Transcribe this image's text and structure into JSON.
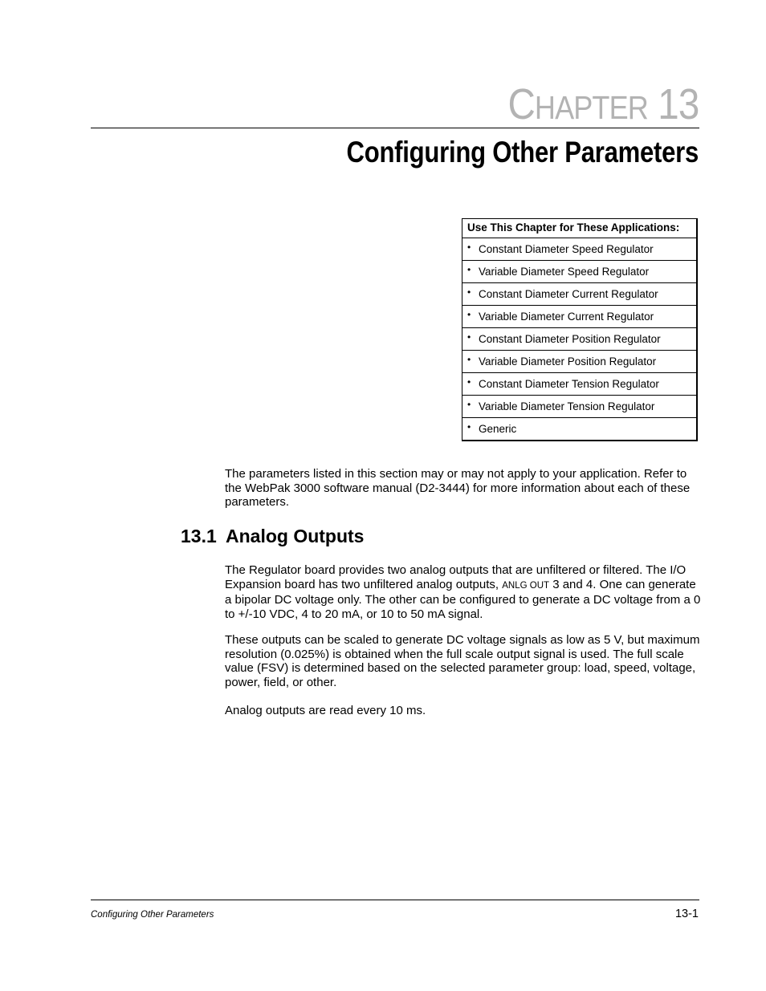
{
  "header": {
    "chapter_label_initial": "C",
    "chapter_label_rest": "HAPTER",
    "chapter_number": "13",
    "chapter_title": "Configuring Other Parameters"
  },
  "applications_table": {
    "heading": "Use This Chapter for These Applications:",
    "bullet": "•",
    "items": [
      "Constant Diameter Speed Regulator",
      "Variable Diameter Speed Regulator",
      "Constant Diameter Current Regulator",
      "Variable Diameter Current Regulator",
      "Constant Diameter Position Regulator",
      "Variable Diameter Position Regulator",
      "Constant Diameter Tension Regulator",
      "Variable Diameter Tension Regulator",
      "Generic"
    ]
  },
  "intro_paragraph": "The parameters listed in this section may or may not apply to your application. Refer to the WebPak 3000 software manual (D2-3444) for more information about each of these parameters.",
  "section": {
    "number": "13.1",
    "title": "Analog Outputs",
    "paragraph1_before": "The Regulator board provides two analog outputs that are unfiltered or filtered. The I/O Expansion board has two unfiltered analog outputs, ",
    "paragraph1_smallcaps": "ANLG OUT",
    "paragraph1_after": " 3 and 4. One can generate a bipolar DC voltage only. The other can be configured to generate a DC voltage from a 0 to +/-10 VDC, 4 to 20 mA, or 10 to 50 mA signal.",
    "paragraph2": "These outputs can be scaled to generate DC voltage signals as low as 5 V, but maximum resolution (0.025%) is obtained when the full scale output signal is used. The full scale value (FSV) is determined based on the selected parameter group: load, speed, voltage, power, field, or other.",
    "paragraph3": "Analog outputs are read every 10 ms."
  },
  "footer": {
    "title": "Configuring Other Parameters",
    "page_number": "13-1"
  }
}
